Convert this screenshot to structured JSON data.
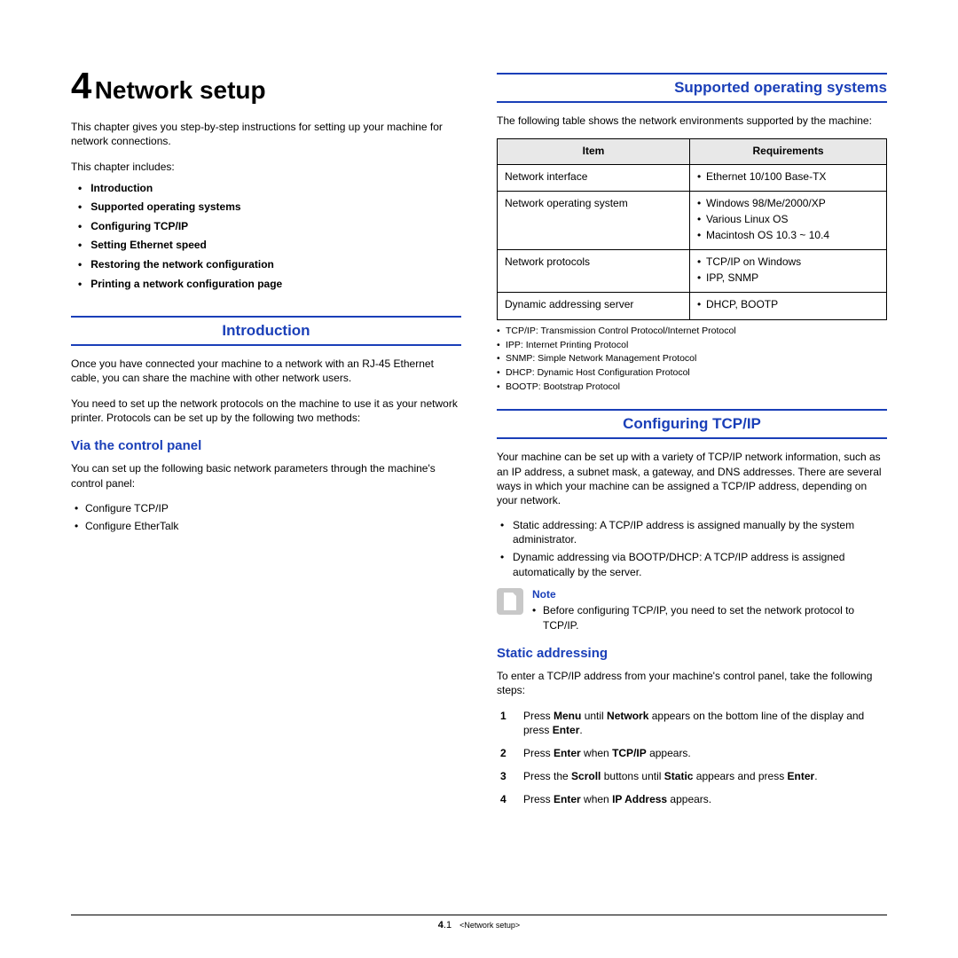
{
  "chapter": {
    "number": "4",
    "title": "Network setup"
  },
  "intro": "This chapter gives you step-by-step instructions for setting up your machine for network connections.",
  "toc_intro": "This chapter includes:",
  "toc": [
    "Introduction",
    "Supported operating systems",
    "Configuring TCP/IP",
    "Setting Ethernet speed",
    "Restoring the network configuration",
    "Printing a network configuration page"
  ],
  "left": {
    "introduction": {
      "heading": "Introduction",
      "p1": "Once you have connected your machine to a network with an RJ-45 Ethernet cable, you can share the machine with other network users.",
      "p2": "You need to set up the network protocols on the machine to use it as your network printer. Protocols can be set up by the following two methods:"
    },
    "via_cp": {
      "heading": "Via the control panel",
      "p1": "You can set up the following basic network parameters through the machine's control panel:",
      "items": [
        "Configure TCP/IP",
        "Configure EtherTalk"
      ]
    }
  },
  "right": {
    "supported": {
      "heading": "Supported operating systems",
      "p1": "The following table shows the network environments supported by the machine:",
      "table": {
        "headers": [
          "Item",
          "Requirements"
        ],
        "rows": [
          {
            "item": "Network interface",
            "reqs": [
              "Ethernet 10/100 Base-TX"
            ]
          },
          {
            "item": "Network operating system",
            "reqs": [
              "Windows 98/Me/2000/XP",
              "Various Linux OS",
              "Macintosh OS 10.3 ~ 10.4"
            ]
          },
          {
            "item": "Network protocols",
            "reqs": [
              "TCP/IP on Windows",
              "IPP, SNMP"
            ]
          },
          {
            "item": "Dynamic addressing server",
            "reqs": [
              "DHCP, BOOTP"
            ]
          }
        ]
      },
      "footnotes": [
        "TCP/IP: Transmission Control Protocol/Internet Protocol",
        "IPP: Internet Printing Protocol",
        "SNMP: Simple Network Management Protocol",
        "DHCP: Dynamic Host Configuration Protocol",
        "BOOTP: Bootstrap Protocol"
      ]
    },
    "tcpip": {
      "heading": "Configuring TCP/IP",
      "p1": "Your machine can be set up with a variety of TCP/IP network information, such as an IP address, a subnet mask, a gateway, and DNS addresses. There are several ways in which your machine can be assigned a TCP/IP address, depending on your network.",
      "items": [
        "Static addressing: A TCP/IP address is assigned manually by the system administrator.",
        "Dynamic addressing via BOOTP/DHCP: A TCP/IP address is assigned automatically by the server."
      ],
      "note": {
        "title": "Note",
        "text": "Before configuring TCP/IP, you need to set the network protocol to TCP/IP."
      }
    },
    "static": {
      "heading": "Static addressing",
      "p1": "To enter a TCP/IP address from your machine's control panel, take the following steps:",
      "steps": [
        {
          "n": "1",
          "html": "Press <b>Menu</b> until <b>Network</b> appears on the bottom line of the display and press <b>Enter</b>."
        },
        {
          "n": "2",
          "html": "Press <b>Enter</b> when <b>TCP/IP</b> appears."
        },
        {
          "n": "3",
          "html": "Press the <b>Scroll</b> buttons until <b>Static</b> appears and press <b>Enter</b>."
        },
        {
          "n": "4",
          "html": "Press <b>Enter</b> when <b>IP Address</b> appears."
        }
      ]
    }
  },
  "footer": {
    "chapter": "4",
    "page": ".1",
    "crumb": "<Network setup>"
  }
}
